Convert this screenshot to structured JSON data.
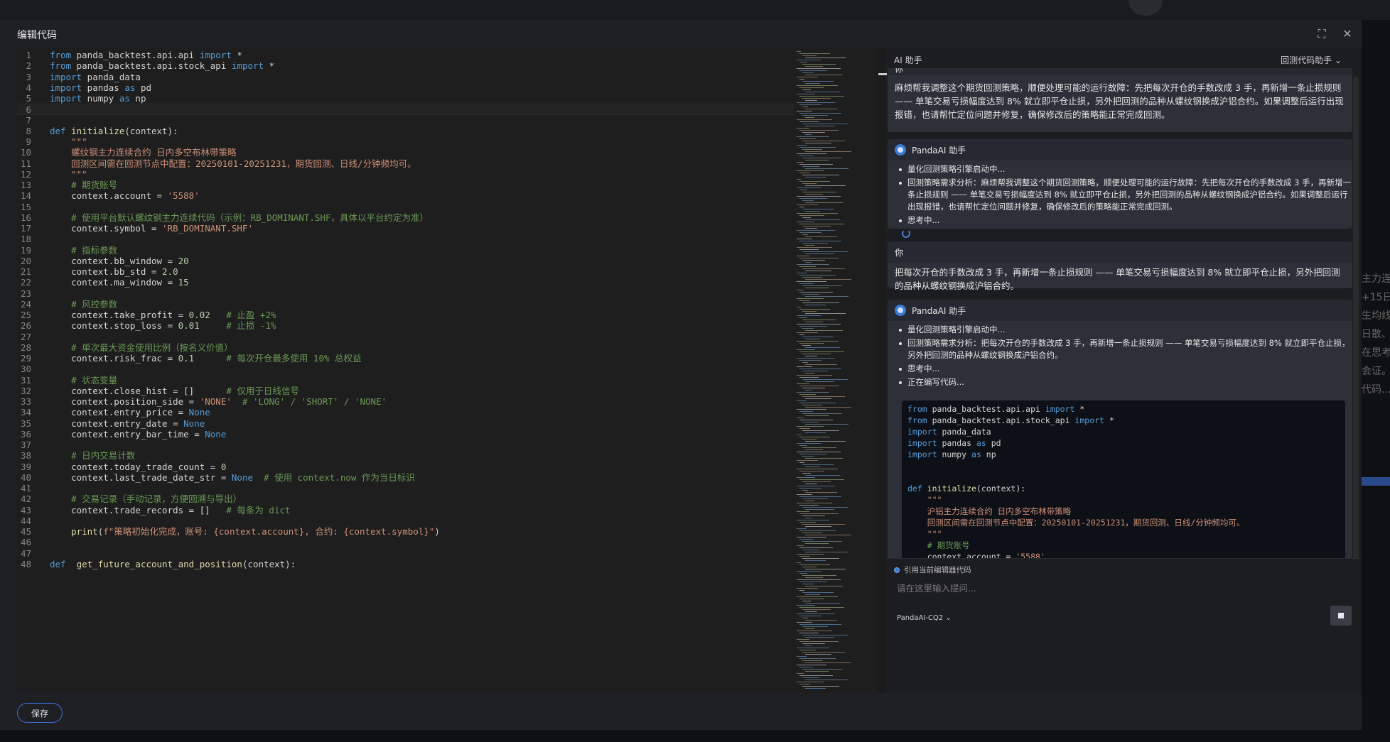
{
  "modal": {
    "title": "编辑代码",
    "save_label": "保存"
  },
  "editor": {
    "lines": [
      [
        {
          "t": "kw",
          "v": "from"
        },
        {
          "t": "pl",
          "v": " panda_backtest.api.api "
        },
        {
          "t": "kw",
          "v": "import"
        },
        {
          "t": "pl",
          "v": " *"
        }
      ],
      [
        {
          "t": "kw",
          "v": "from"
        },
        {
          "t": "pl",
          "v": " panda_backtest.api.stock_api "
        },
        {
          "t": "kw",
          "v": "import"
        },
        {
          "t": "pl",
          "v": " *"
        }
      ],
      [
        {
          "t": "kw",
          "v": "import"
        },
        {
          "t": "pl",
          "v": " panda_data"
        }
      ],
      [
        {
          "t": "kw",
          "v": "import"
        },
        {
          "t": "pl",
          "v": " pandas "
        },
        {
          "t": "kw",
          "v": "as"
        },
        {
          "t": "pl",
          "v": " pd"
        }
      ],
      [
        {
          "t": "kw",
          "v": "import"
        },
        {
          "t": "pl",
          "v": " numpy "
        },
        {
          "t": "kw",
          "v": "as"
        },
        {
          "t": "pl",
          "v": " np"
        }
      ],
      [],
      [],
      [
        {
          "t": "kw",
          "v": "def"
        },
        {
          "t": "pl",
          "v": " "
        },
        {
          "t": "fn",
          "v": "initialize"
        },
        {
          "t": "pl",
          "v": "(context):"
        }
      ],
      [
        {
          "t": "str",
          "v": "    \"\"\""
        }
      ],
      [
        {
          "t": "str",
          "v": "    螺纹钢主力连续合约 日内多空布林带策略"
        }
      ],
      [
        {
          "t": "str",
          "v": "    回测区间需在回测节点中配置：20250101-20251231，期货回测、日线/分钟频均可。"
        }
      ],
      [
        {
          "t": "str",
          "v": "    \"\"\""
        }
      ],
      [
        {
          "t": "cm",
          "v": "    # 期货账号"
        }
      ],
      [
        {
          "t": "pl",
          "v": "    context.account = "
        },
        {
          "t": "str",
          "v": "'5588'"
        }
      ],
      [],
      [
        {
          "t": "cm",
          "v": "    # 使用平台默认螺纹钢主力连续代码（示例：RB_DOMINANT.SHF，具体以平台约定为准）"
        }
      ],
      [
        {
          "t": "pl",
          "v": "    context.symbol = "
        },
        {
          "t": "str",
          "v": "'RB_DOMINANT.SHF'"
        }
      ],
      [],
      [
        {
          "t": "cm",
          "v": "    # 指标参数"
        }
      ],
      [
        {
          "t": "pl",
          "v": "    context.bb_window = "
        },
        {
          "t": "num",
          "v": "20"
        }
      ],
      [
        {
          "t": "pl",
          "v": "    context.bb_std = "
        },
        {
          "t": "num",
          "v": "2.0"
        }
      ],
      [
        {
          "t": "pl",
          "v": "    context.ma_window = "
        },
        {
          "t": "num",
          "v": "15"
        }
      ],
      [],
      [
        {
          "t": "cm",
          "v": "    # 风控参数"
        }
      ],
      [
        {
          "t": "pl",
          "v": "    context.take_profit = "
        },
        {
          "t": "num",
          "v": "0.02"
        },
        {
          "t": "cm",
          "v": "   # 止盈 +2%"
        }
      ],
      [
        {
          "t": "pl",
          "v": "    context.stop_loss = "
        },
        {
          "t": "num",
          "v": "0.01"
        },
        {
          "t": "cm",
          "v": "     # 止损 -1%"
        }
      ],
      [],
      [
        {
          "t": "cm",
          "v": "    # 单次最大资金使用比例（按名义价值）"
        }
      ],
      [
        {
          "t": "pl",
          "v": "    context.risk_frac = "
        },
        {
          "t": "num",
          "v": "0.1"
        },
        {
          "t": "cm",
          "v": "      # 每次开仓最多使用 10% 总权益"
        }
      ],
      [],
      [
        {
          "t": "cm",
          "v": "    # 状态变量"
        }
      ],
      [
        {
          "t": "pl",
          "v": "    context.close_hist = []"
        },
        {
          "t": "cm",
          "v": "      # 仅用于日线信号"
        }
      ],
      [
        {
          "t": "pl",
          "v": "    context.position_side = "
        },
        {
          "t": "str",
          "v": "'NONE'"
        },
        {
          "t": "cm",
          "v": "  # 'LONG' / 'SHORT' / 'NONE'"
        }
      ],
      [
        {
          "t": "pl",
          "v": "    context.entry_price = "
        },
        {
          "t": "cn",
          "v": "None"
        }
      ],
      [
        {
          "t": "pl",
          "v": "    context.entry_date = "
        },
        {
          "t": "cn",
          "v": "None"
        }
      ],
      [
        {
          "t": "pl",
          "v": "    context.entry_bar_time = "
        },
        {
          "t": "cn",
          "v": "None"
        }
      ],
      [],
      [
        {
          "t": "cm",
          "v": "    # 日内交易计数"
        }
      ],
      [
        {
          "t": "pl",
          "v": "    context.today_trade_count = "
        },
        {
          "t": "num",
          "v": "0"
        }
      ],
      [
        {
          "t": "pl",
          "v": "    context.last_trade_date_str = "
        },
        {
          "t": "cn",
          "v": "None"
        },
        {
          "t": "cm",
          "v": "  # 使用 context.now 作为当日标识"
        }
      ],
      [],
      [
        {
          "t": "cm",
          "v": "    # 交易记录（手动记录，方便回溯与导出）"
        }
      ],
      [
        {
          "t": "pl",
          "v": "    context.trade_records = []"
        },
        {
          "t": "cm",
          "v": "   # 每条为 dict"
        }
      ],
      [],
      [
        {
          "t": "pl",
          "v": "    "
        },
        {
          "t": "fn",
          "v": "print"
        },
        {
          "t": "pl",
          "v": "("
        },
        {
          "t": "str",
          "v": "f\"策略初始化完成，账号: {context.account}, 合约: {context.symbol}\""
        },
        {
          "t": "pl",
          "v": ")"
        }
      ],
      [],
      [],
      [
        {
          "t": "kw",
          "v": "def"
        },
        {
          "t": "pl",
          "v": "  "
        },
        {
          "t": "fn",
          "v": "get_future_account_and_position"
        },
        {
          "t": "pl",
          "v": "(context):"
        }
      ]
    ]
  },
  "ai": {
    "title": "AI 助手",
    "mode": "回测代码助手",
    "user_label": "你",
    "bot_label": "PandaAI 助手",
    "msg1": "麻烦帮我调整这个期货回测策略，顺便处理可能的运行故障：先把每次开仓的手数改成 3 手，再新增一条止损规则 —— 单笔交易亏损幅度达到 8% 就立即平仓止损，另外把回测的品种从螺纹钢换成沪铝合约。如果调整后运行出现报错，也请帮忙定位问题并修复，确保修改后的策略能正常完成回测。",
    "bot1": [
      "量化回测策略引擎启动中...",
      "回测策略需求分析：麻烦帮我调整这个期货回测策略，顺便处理可能的运行故障：先把每次开仓的手数改成 3 手，再新增一条止损规则 —— 单笔交易亏损幅度达到 8% 就立即平仓止损，另外把回测的品种从螺纹钢换成沪铝合约。如果调整后运行出现报错，也请帮忙定位问题并修复，确保修改后的策略能正常完成回测。",
      "思考中..."
    ],
    "msg2": "把每次开仓的手数改成 3 手，再新增一条止损规则 —— 单笔交易亏损幅度达到 8% 就立即平仓止损，另外把回测的品种从螺纹钢换成沪铝合约。",
    "bot2": [
      "量化回测策略引擎启动中...",
      "回测策略需求分析：把每次开仓的手数改成 3 手，再新增一条止损规则 —— 单笔交易亏损幅度达到 8% 就立即平仓止损，另外把回测的品种从螺纹钢换成沪铝合约。",
      "思考中...",
      "正在编写代码..."
    ],
    "code_preview": [
      [
        {
          "t": "kw",
          "v": "from"
        },
        {
          "t": "pl",
          "v": " panda_backtest.api.api "
        },
        {
          "t": "kw",
          "v": "import"
        },
        {
          "t": "pl",
          "v": " *"
        }
      ],
      [
        {
          "t": "kw",
          "v": "from"
        },
        {
          "t": "pl",
          "v": " panda_backtest.api.stock_api "
        },
        {
          "t": "kw",
          "v": "import"
        },
        {
          "t": "pl",
          "v": " *"
        }
      ],
      [
        {
          "t": "kw",
          "v": "import"
        },
        {
          "t": "pl",
          "v": " panda_data"
        }
      ],
      [
        {
          "t": "kw",
          "v": "import"
        },
        {
          "t": "pl",
          "v": " pandas "
        },
        {
          "t": "kw",
          "v": "as"
        },
        {
          "t": "pl",
          "v": " pd"
        }
      ],
      [
        {
          "t": "kw",
          "v": "import"
        },
        {
          "t": "pl",
          "v": " numpy "
        },
        {
          "t": "kw",
          "v": "as"
        },
        {
          "t": "pl",
          "v": " np"
        }
      ],
      [],
      [],
      [
        {
          "t": "kw",
          "v": "def"
        },
        {
          "t": "pl",
          "v": " "
        },
        {
          "t": "fn",
          "v": "initialize"
        },
        {
          "t": "pl",
          "v": "(context):"
        }
      ],
      [
        {
          "t": "str",
          "v": "    \"\"\""
        }
      ],
      [
        {
          "t": "str",
          "v": "    沪铝主力连续合约 日内多空布林带策略"
        }
      ],
      [
        {
          "t": "str",
          "v": "    回测区间需在回测节点中配置：20250101-20251231，期货回测、日线/分钟频均可。"
        }
      ],
      [
        {
          "t": "str",
          "v": "    \"\"\""
        }
      ],
      [
        {
          "t": "cm",
          "v": "    # 期货账号"
        }
      ],
      [
        {
          "t": "pl",
          "v": "    context.account = "
        },
        {
          "t": "str",
          "v": "'5588'"
        }
      ]
    ],
    "quote_label": "引用当前编辑器代码",
    "input_placeholder": "请在这里输入提问...",
    "model": "PandaAI-CQ2"
  },
  "background": {
    "side_text": [
      "主力连",
      "+15日",
      "生均线",
      "日散、",
      "在思考",
      "会证。",
      "",
      "代码..."
    ]
  },
  "colors": {
    "accent": "#3b6fd8",
    "keyword": "#569cd6",
    "string": "#ce9178",
    "comment": "#6a9955"
  }
}
